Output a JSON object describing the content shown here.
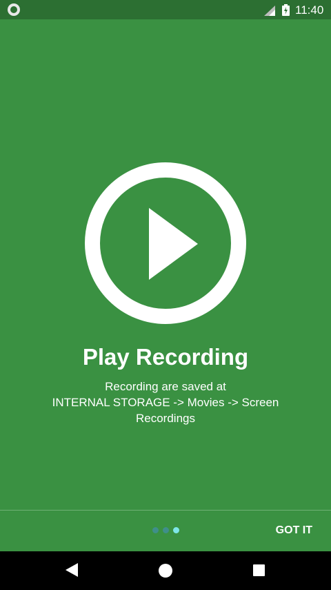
{
  "status_bar": {
    "time": "11:40",
    "icons": [
      "notification-circle-icon",
      "cell-signal-icon",
      "battery-charging-icon"
    ]
  },
  "onboarding": {
    "illustration_icon": "play-circle-icon",
    "title": "Play Recording",
    "description_line1": "Recording are saved at",
    "description_line2": "INTERNAL STORAGE -> Movies -> Screen Recordings",
    "page_indicator": {
      "total": 3,
      "current": 3
    },
    "got_it_label": "GOT IT"
  },
  "nav_bar": {
    "icons": [
      "back-icon",
      "home-icon",
      "recents-icon"
    ]
  },
  "colors": {
    "background": "#3a9142",
    "status_bar": "#2c6f32",
    "dot_inactive": "#3f8f8a",
    "dot_active": "#7fe6e8",
    "text": "#ffffff"
  }
}
